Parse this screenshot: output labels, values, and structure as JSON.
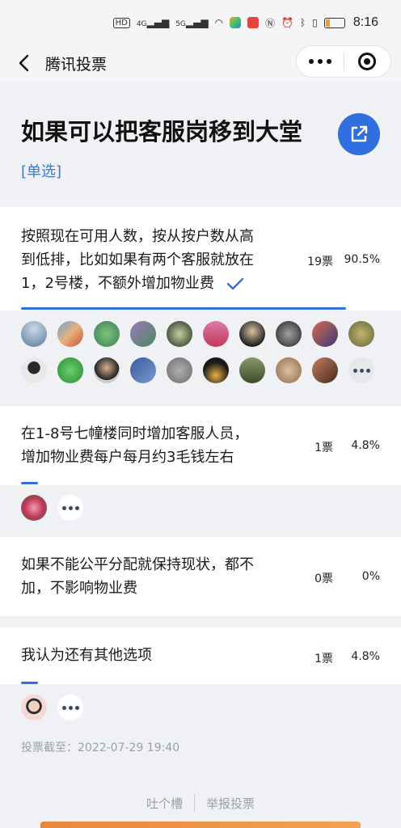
{
  "status_bar": {
    "network_left": "4G",
    "network_right": "5G",
    "time": "8:16"
  },
  "nav": {
    "title": "腾讯投票"
  },
  "poll": {
    "title": "如果可以把客服岗移到大堂",
    "type": "[单选]",
    "options": [
      {
        "line1": "按照现在可用人数，按从按户数从高",
        "line2": "到低排，比如如果有两个客服就放在",
        "line3": "1，2号楼，不额外增加物业费",
        "votes": "19票",
        "percent": "90.5%",
        "share": 0.905,
        "selected": true
      },
      {
        "line1": "在1-8号七幢楼同时增加客服人员，",
        "line2": "增加物业费每户每月约3毛钱左右",
        "votes": "1票",
        "percent": "4.8%",
        "share": 0.048,
        "selected": false
      },
      {
        "line1": "如果不能公平分配就保持现状，都不",
        "line2": "加，不影响物业费",
        "votes": "0票",
        "percent": "0%",
        "share": 0,
        "selected": false
      },
      {
        "line1": "我认为还有其他选项",
        "votes": "1票",
        "percent": "4.8%",
        "share": 0.048,
        "selected": false
      }
    ],
    "deadline": "投票截至：2022-07-29 19:40"
  },
  "footer": {
    "feedback": "吐个槽",
    "report": "举报投票"
  },
  "colors": {
    "accent": "#2f6fe0",
    "type_label": "#3a78d6",
    "muted": "#9aa0ab"
  }
}
